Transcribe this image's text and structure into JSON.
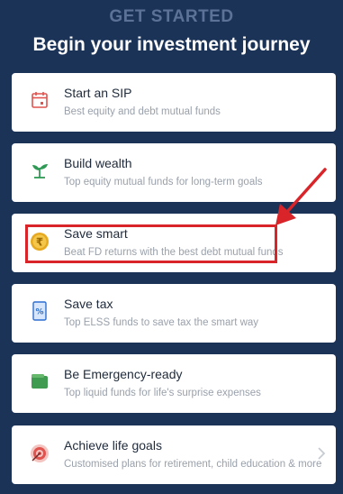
{
  "header": {
    "eyebrow": "GET STARTED",
    "headline": "Begin your investment journey"
  },
  "cards": [
    {
      "title": "Start an SIP",
      "subtitle": "Best equity and debt mutual funds",
      "icon": "calendar-icon"
    },
    {
      "title": "Build wealth",
      "subtitle": "Top equity mutual funds for long-term goals",
      "icon": "sprout-icon"
    },
    {
      "title": "Save smart",
      "subtitle": "Beat FD returns with the best debt mutual funds",
      "icon": "rupee-coin-icon"
    },
    {
      "title": "Save tax",
      "subtitle": "Top ELSS funds to save tax the smart way",
      "icon": "tax-receipt-icon"
    },
    {
      "title": "Be Emergency-ready",
      "subtitle": "Top liquid funds for life's surprise expenses",
      "icon": "wallet-icon"
    },
    {
      "title": "Achieve life goals",
      "subtitle": "Customised plans for retirement, child education & more",
      "icon": "target-icon"
    }
  ],
  "colors": {
    "background": "#1c3358",
    "annotation": "#d9252a",
    "icon_red": "#e0534e",
    "icon_green": "#2f9a55",
    "icon_gold": "#e6a91f",
    "icon_blue": "#2f6fd1"
  }
}
